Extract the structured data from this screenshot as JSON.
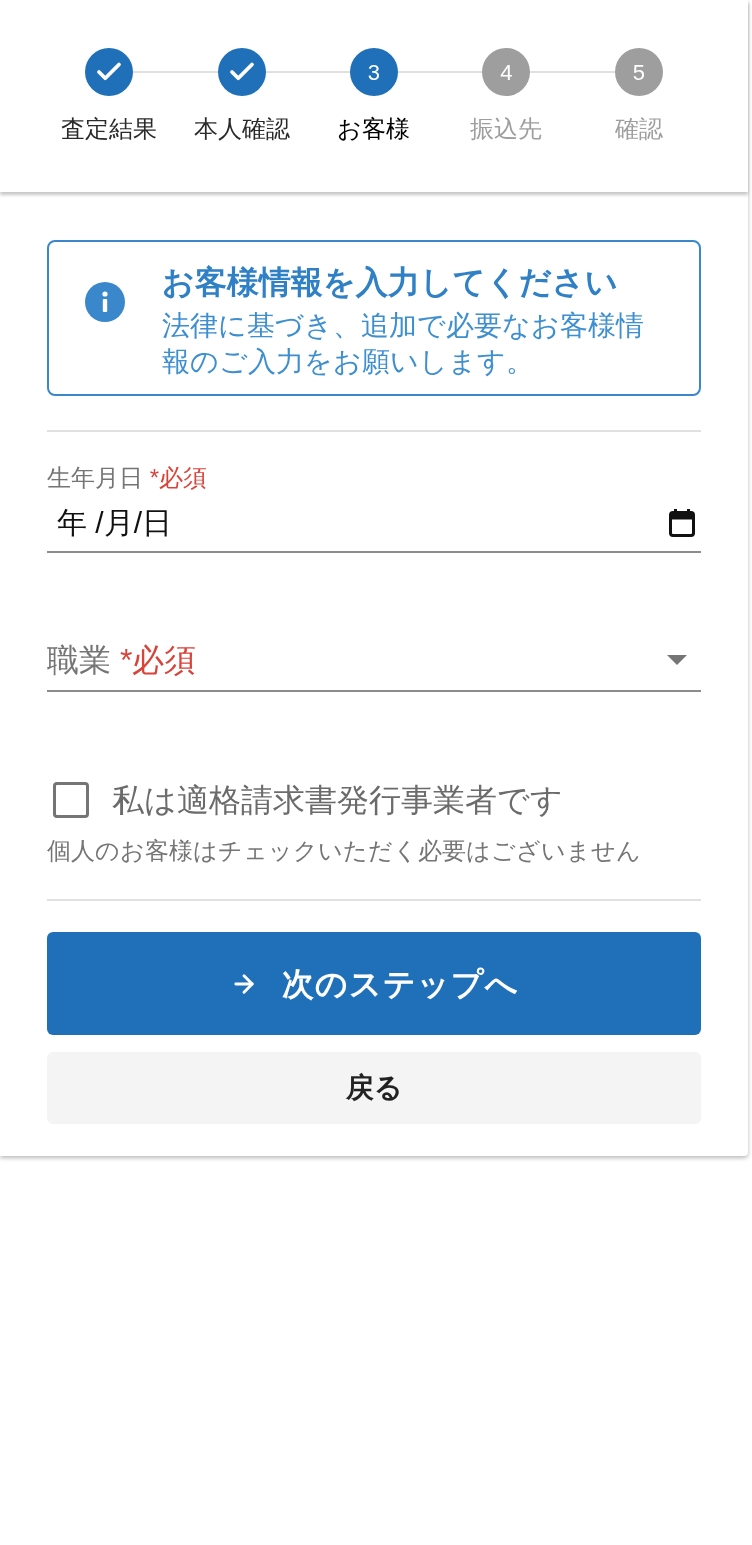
{
  "stepper": {
    "steps": [
      {
        "label": "査定結果",
        "completed": true,
        "active": false
      },
      {
        "label": "本人確認",
        "completed": true,
        "active": false
      },
      {
        "number": "3",
        "label": "お客様",
        "completed": false,
        "active": true
      },
      {
        "number": "4",
        "label": "振込先",
        "completed": false,
        "active": false
      },
      {
        "number": "5",
        "label": "確認",
        "completed": false,
        "active": false
      }
    ]
  },
  "notice": {
    "title": "お客様情報を入力してください",
    "body": "法律に基づき、追加で必要なお客様情報のご入力をお願いします。"
  },
  "form": {
    "fields": [
      {
        "kind": "date",
        "label": "生年月日",
        "required_mark": "*必須",
        "placeholder": "年 /月/日"
      },
      {
        "kind": "select",
        "label": "職業",
        "required_mark": "*必須"
      }
    ],
    "checkbox": {
      "label": "私は適格請求書発行事業者です",
      "checked": false,
      "helper": "個人のお客様はチェックいただく必要はございません"
    }
  },
  "buttons": [
    {
      "kind": "primary",
      "label": "次のステップへ"
    },
    {
      "kind": "secondary",
      "label": "戻る"
    }
  ]
}
